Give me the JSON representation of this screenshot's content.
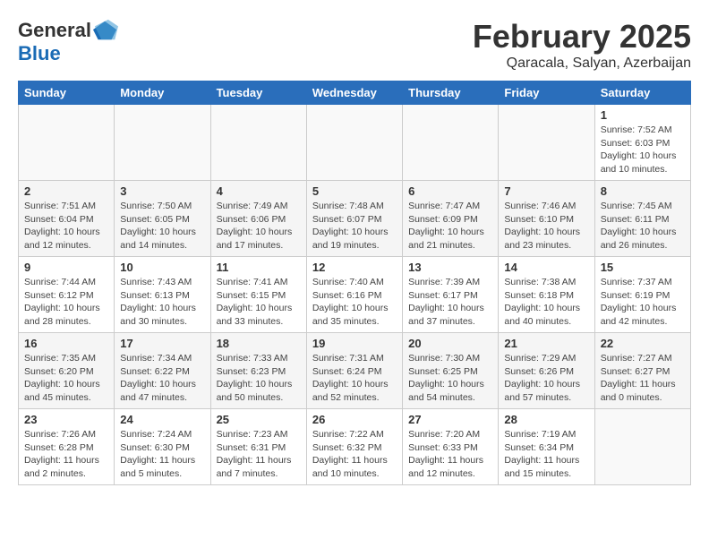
{
  "header": {
    "logo_general": "General",
    "logo_blue": "Blue",
    "month_title": "February 2025",
    "location": "Qaracala, Salyan, Azerbaijan"
  },
  "weekdays": [
    "Sunday",
    "Monday",
    "Tuesday",
    "Wednesday",
    "Thursday",
    "Friday",
    "Saturday"
  ],
  "weeks": [
    [
      {
        "day": "",
        "info": ""
      },
      {
        "day": "",
        "info": ""
      },
      {
        "day": "",
        "info": ""
      },
      {
        "day": "",
        "info": ""
      },
      {
        "day": "",
        "info": ""
      },
      {
        "day": "",
        "info": ""
      },
      {
        "day": "1",
        "info": "Sunrise: 7:52 AM\nSunset: 6:03 PM\nDaylight: 10 hours\nand 10 minutes."
      }
    ],
    [
      {
        "day": "2",
        "info": "Sunrise: 7:51 AM\nSunset: 6:04 PM\nDaylight: 10 hours\nand 12 minutes."
      },
      {
        "day": "3",
        "info": "Sunrise: 7:50 AM\nSunset: 6:05 PM\nDaylight: 10 hours\nand 14 minutes."
      },
      {
        "day": "4",
        "info": "Sunrise: 7:49 AM\nSunset: 6:06 PM\nDaylight: 10 hours\nand 17 minutes."
      },
      {
        "day": "5",
        "info": "Sunrise: 7:48 AM\nSunset: 6:07 PM\nDaylight: 10 hours\nand 19 minutes."
      },
      {
        "day": "6",
        "info": "Sunrise: 7:47 AM\nSunset: 6:09 PM\nDaylight: 10 hours\nand 21 minutes."
      },
      {
        "day": "7",
        "info": "Sunrise: 7:46 AM\nSunset: 6:10 PM\nDaylight: 10 hours\nand 23 minutes."
      },
      {
        "day": "8",
        "info": "Sunrise: 7:45 AM\nSunset: 6:11 PM\nDaylight: 10 hours\nand 26 minutes."
      }
    ],
    [
      {
        "day": "9",
        "info": "Sunrise: 7:44 AM\nSunset: 6:12 PM\nDaylight: 10 hours\nand 28 minutes."
      },
      {
        "day": "10",
        "info": "Sunrise: 7:43 AM\nSunset: 6:13 PM\nDaylight: 10 hours\nand 30 minutes."
      },
      {
        "day": "11",
        "info": "Sunrise: 7:41 AM\nSunset: 6:15 PM\nDaylight: 10 hours\nand 33 minutes."
      },
      {
        "day": "12",
        "info": "Sunrise: 7:40 AM\nSunset: 6:16 PM\nDaylight: 10 hours\nand 35 minutes."
      },
      {
        "day": "13",
        "info": "Sunrise: 7:39 AM\nSunset: 6:17 PM\nDaylight: 10 hours\nand 37 minutes."
      },
      {
        "day": "14",
        "info": "Sunrise: 7:38 AM\nSunset: 6:18 PM\nDaylight: 10 hours\nand 40 minutes."
      },
      {
        "day": "15",
        "info": "Sunrise: 7:37 AM\nSunset: 6:19 PM\nDaylight: 10 hours\nand 42 minutes."
      }
    ],
    [
      {
        "day": "16",
        "info": "Sunrise: 7:35 AM\nSunset: 6:20 PM\nDaylight: 10 hours\nand 45 minutes."
      },
      {
        "day": "17",
        "info": "Sunrise: 7:34 AM\nSunset: 6:22 PM\nDaylight: 10 hours\nand 47 minutes."
      },
      {
        "day": "18",
        "info": "Sunrise: 7:33 AM\nSunset: 6:23 PM\nDaylight: 10 hours\nand 50 minutes."
      },
      {
        "day": "19",
        "info": "Sunrise: 7:31 AM\nSunset: 6:24 PM\nDaylight: 10 hours\nand 52 minutes."
      },
      {
        "day": "20",
        "info": "Sunrise: 7:30 AM\nSunset: 6:25 PM\nDaylight: 10 hours\nand 54 minutes."
      },
      {
        "day": "21",
        "info": "Sunrise: 7:29 AM\nSunset: 6:26 PM\nDaylight: 10 hours\nand 57 minutes."
      },
      {
        "day": "22",
        "info": "Sunrise: 7:27 AM\nSunset: 6:27 PM\nDaylight: 11 hours\nand 0 minutes."
      }
    ],
    [
      {
        "day": "23",
        "info": "Sunrise: 7:26 AM\nSunset: 6:28 PM\nDaylight: 11 hours\nand 2 minutes."
      },
      {
        "day": "24",
        "info": "Sunrise: 7:24 AM\nSunset: 6:30 PM\nDaylight: 11 hours\nand 5 minutes."
      },
      {
        "day": "25",
        "info": "Sunrise: 7:23 AM\nSunset: 6:31 PM\nDaylight: 11 hours\nand 7 minutes."
      },
      {
        "day": "26",
        "info": "Sunrise: 7:22 AM\nSunset: 6:32 PM\nDaylight: 11 hours\nand 10 minutes."
      },
      {
        "day": "27",
        "info": "Sunrise: 7:20 AM\nSunset: 6:33 PM\nDaylight: 11 hours\nand 12 minutes."
      },
      {
        "day": "28",
        "info": "Sunrise: 7:19 AM\nSunset: 6:34 PM\nDaylight: 11 hours\nand 15 minutes."
      },
      {
        "day": "",
        "info": ""
      }
    ]
  ]
}
